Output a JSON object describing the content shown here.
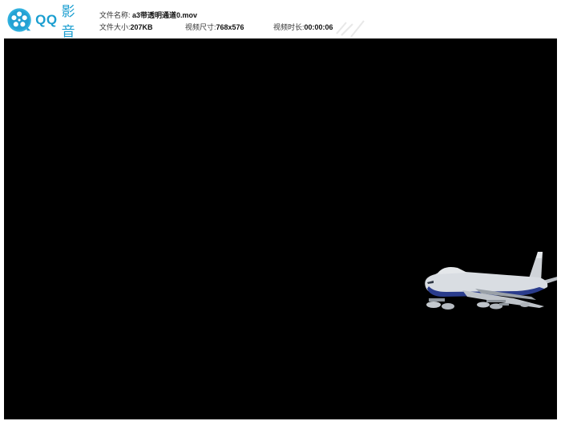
{
  "app": {
    "logo_text_latin": "QQ",
    "logo_text_cn": "影音",
    "brand_color": "#1a9ed0"
  },
  "file_info": {
    "name_label": "文件名称:",
    "name_value": "a3带透明通道0.mov",
    "size_label": "文件大小:",
    "size_value": "207KB",
    "dimension_label": "视频尺寸:",
    "dimension_value": "768x576",
    "duration_label": "视频时长:",
    "duration_value": "00:00:06"
  },
  "video": {
    "background": "#000000",
    "subject": "airplane-icon"
  }
}
